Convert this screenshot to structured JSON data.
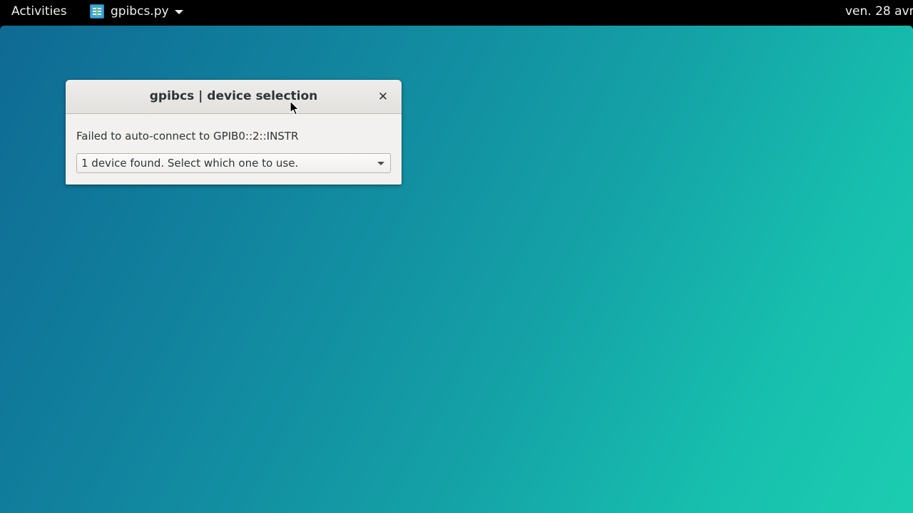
{
  "topbar": {
    "activities_label": "Activities",
    "app_name": "gpibcs.py",
    "app_icon": "spreadsheet-app-icon",
    "clock": "ven. 28 avr"
  },
  "dialog": {
    "title": "gpibcs | device selection",
    "close_glyph": "✕",
    "message": "Failed to auto-connect to GPIB0::2::INSTR",
    "select": {
      "selected": "1 device found. Select which one to use."
    }
  },
  "colors": {
    "desktop_start": "#0f6a94",
    "desktop_end": "#1ccdb0",
    "dialog_bg": "#f2f1f0",
    "text": "#2e3436"
  }
}
